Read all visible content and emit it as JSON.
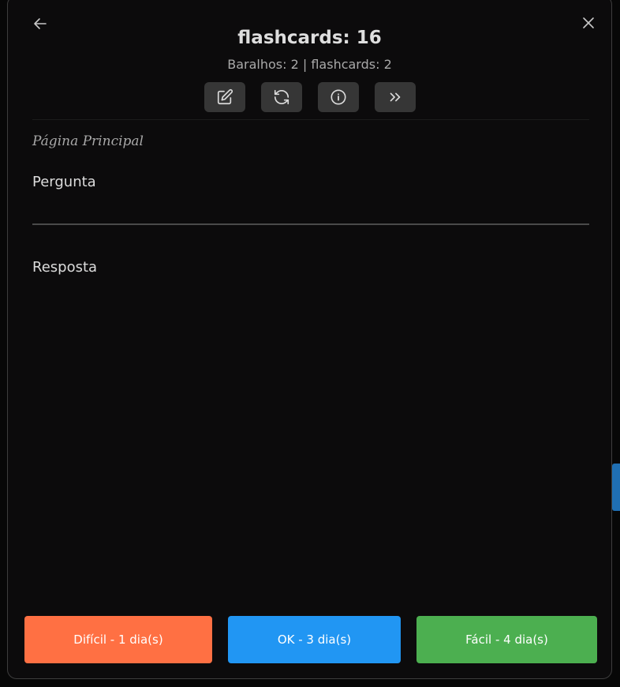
{
  "header": {
    "title": "flashcards: 16",
    "subtitle": "Baralhos: 2 | flashcards: 2"
  },
  "toolbar": {
    "buttons": [
      {
        "icon": "edit-icon"
      },
      {
        "icon": "refresh-icon"
      },
      {
        "icon": "info-icon"
      },
      {
        "icon": "skip-forward-icon"
      }
    ]
  },
  "card": {
    "breadcrumb": "Página Principal",
    "question": "Pergunta",
    "answer": "Resposta"
  },
  "ratings": {
    "hard_label": "Difícil - 1 dia(s)",
    "ok_label": "OK - 3 dia(s)",
    "easy_label": "Fácil - 4 dia(s)"
  },
  "colors": {
    "hard": "#ff7043",
    "ok": "#2196f3",
    "easy": "#4caf50",
    "background": "#0c0b0c"
  }
}
